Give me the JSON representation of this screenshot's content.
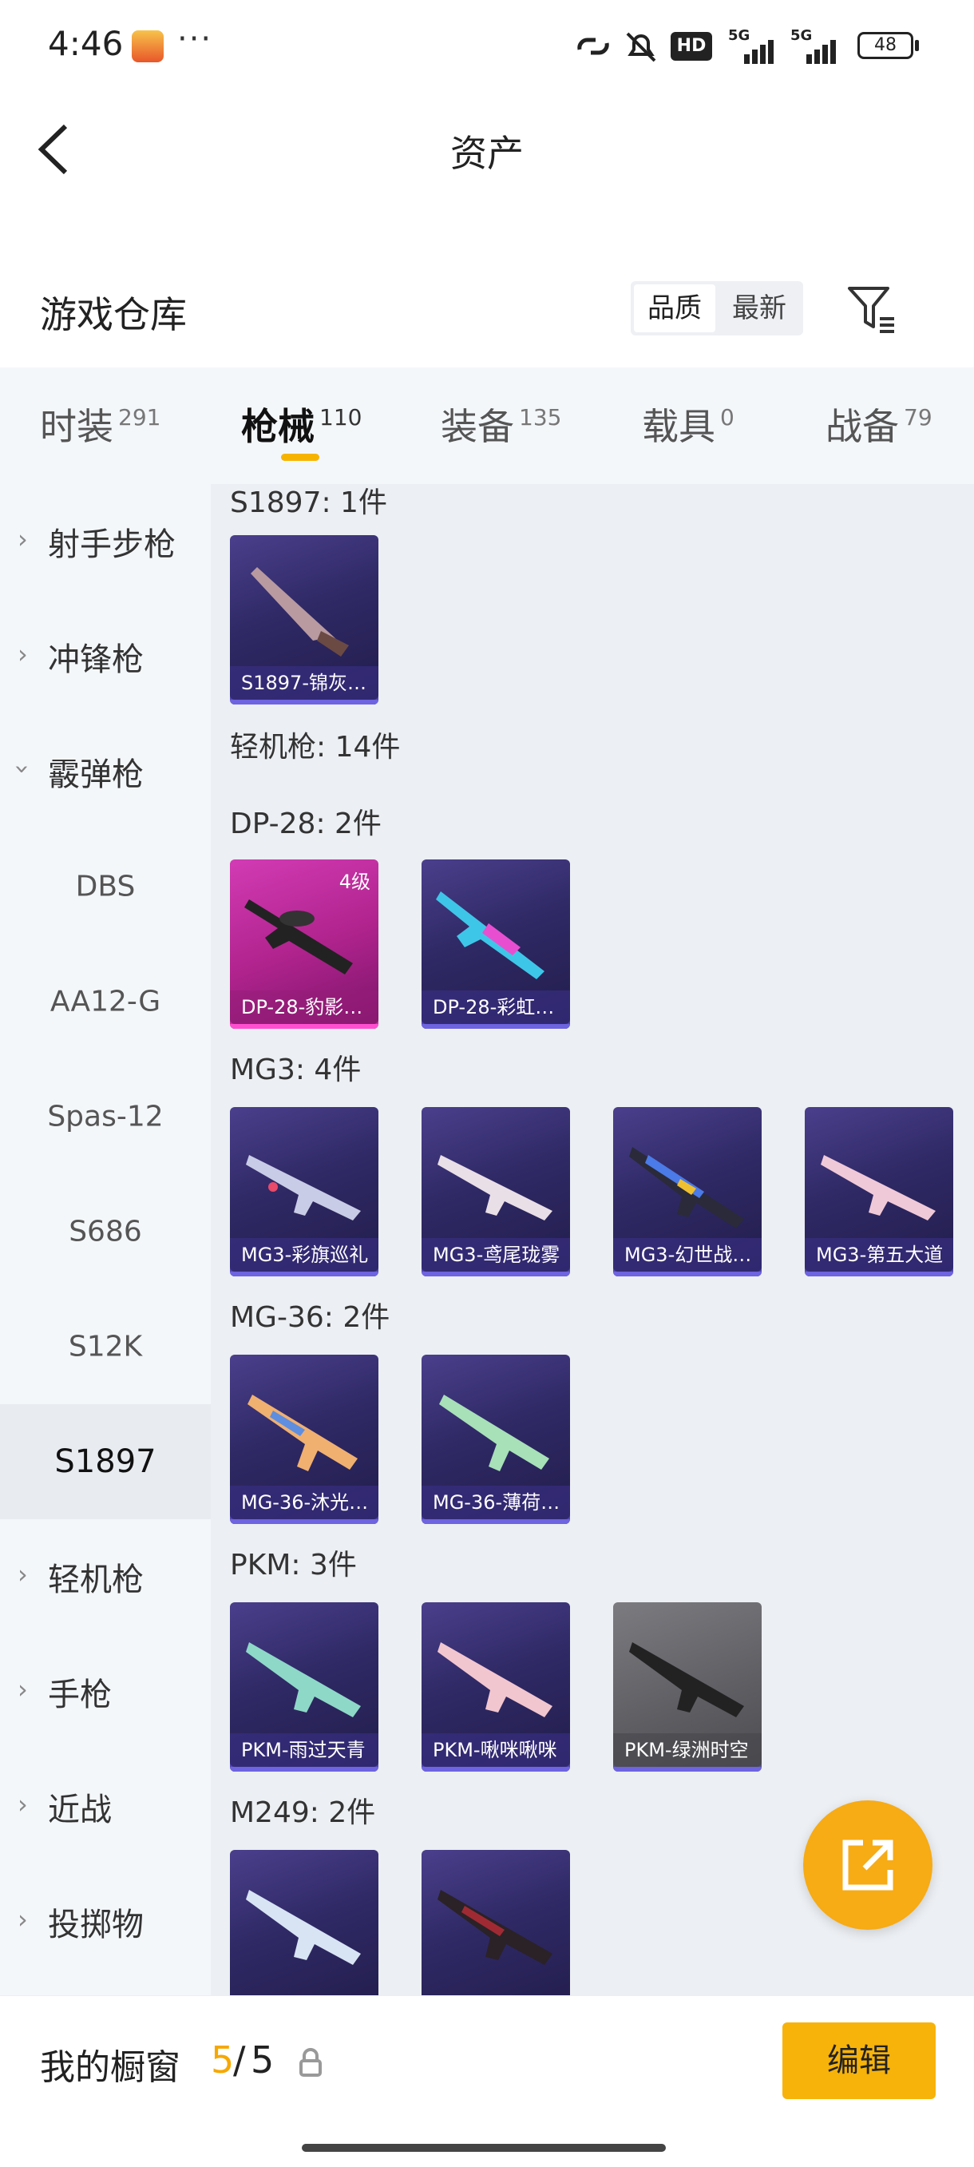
{
  "status_bar": {
    "time": "4:46",
    "dots": "···",
    "hd": "HD",
    "net1": "5G",
    "net2": "5G",
    "battery": "48"
  },
  "header": {
    "title": "资产"
  },
  "warehouse": {
    "title": "游戏仓库",
    "sort_quality": "品质",
    "sort_latest": "最新"
  },
  "tabs": [
    {
      "label": "时装",
      "count": "291"
    },
    {
      "label": "枪械",
      "count": "110"
    },
    {
      "label": "装备",
      "count": "135"
    },
    {
      "label": "载具",
      "count": "0"
    },
    {
      "label": "战备",
      "count": "79"
    }
  ],
  "sidebar": {
    "items": [
      "射手步枪",
      "冲锋枪",
      "霰弹枪",
      "DBS",
      "AA12-G",
      "Spas-12",
      "S686",
      "S12K",
      "S1897",
      "轻机枪",
      "手枪",
      "近战",
      "投掷物"
    ]
  },
  "content": {
    "groups": [
      {
        "label": "S1897: 1件"
      },
      {
        "label": "轻机枪: 14件"
      },
      {
        "label": "DP-28: 2件"
      },
      {
        "label": "MG3: 4件"
      },
      {
        "label": "MG-36: 2件"
      },
      {
        "label": "PKM: 3件"
      },
      {
        "label": "M249: 2件"
      }
    ],
    "cards": {
      "s1897_1": {
        "name": "S1897-锦灰…"
      },
      "dp28_1": {
        "name": "DP-28-豹影…",
        "badge": "4级"
      },
      "dp28_2": {
        "name": "DP-28-彩虹…"
      },
      "mg3_1": {
        "name": "MG3-彩旗巡礼"
      },
      "mg3_2": {
        "name": "MG3-鸢尾珑雾"
      },
      "mg3_3": {
        "name": "MG3-幻世战…"
      },
      "mg3_4": {
        "name": "MG3-第五大道"
      },
      "mg36_1": {
        "name": "MG-36-沐光…"
      },
      "mg36_2": {
        "name": "MG-36-薄荷…"
      },
      "pkm_1": {
        "name": "PKM-雨过天青"
      },
      "pkm_2": {
        "name": "PKM-啾咪啾咪"
      },
      "pkm_3": {
        "name": "PKM-绿洲时空"
      }
    }
  },
  "bottom_bar": {
    "showcase_label": "我的橱窗",
    "current": "5",
    "separator": "/",
    "total": "5",
    "edit_label": "编辑"
  },
  "colors": {
    "accent": "#f7b30a",
    "card_purple": "#2f2965",
    "card_pink": "#b2248f",
    "card_grey": "#5d5d62"
  }
}
